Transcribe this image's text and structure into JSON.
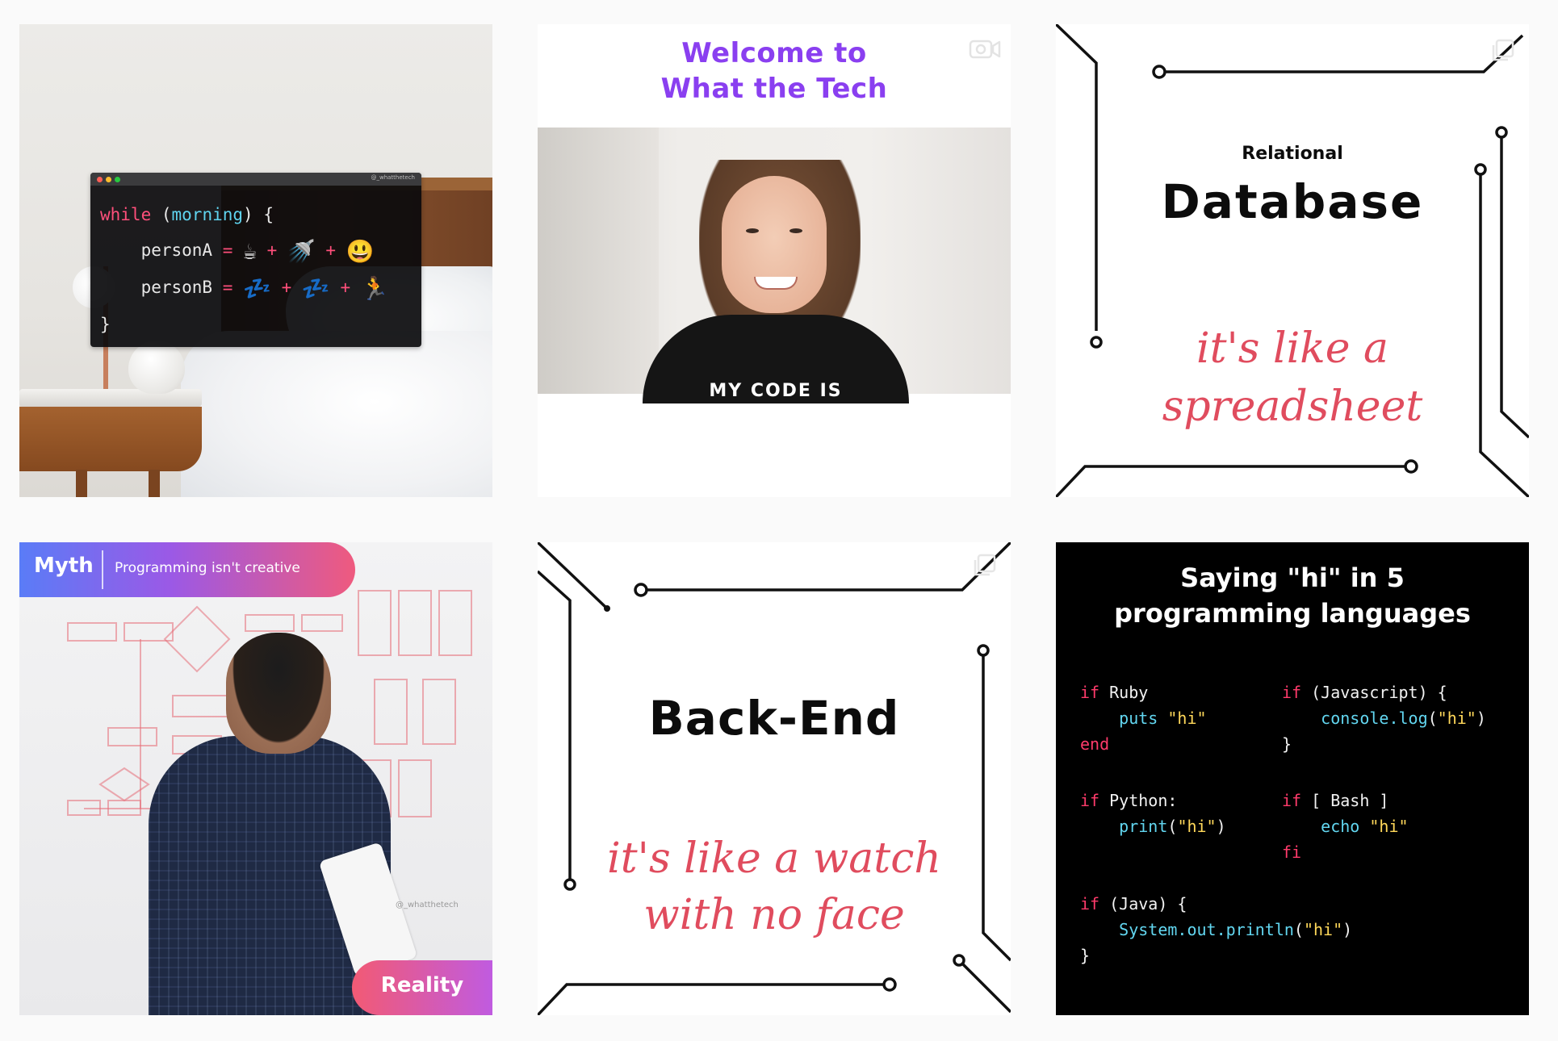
{
  "tiles": {
    "tile1": {
      "handle": "@_whatthetech",
      "code": {
        "line1_kw": "while",
        "line1_open": " (",
        "line1_var": "morning",
        "line1_close": ") {",
        "personA": "personA",
        "personB": "personB",
        "eq": "=",
        "plus": "+",
        "close": "}",
        "personA_emojis": [
          "☕",
          "🚿",
          "😃"
        ],
        "personB_emojis": [
          "💤",
          "💤",
          "🏃"
        ]
      }
    },
    "tile2": {
      "welcome_line1": "Welcome to",
      "welcome_line2": "What the Tech",
      "shirt_text": "MY CODE IS"
    },
    "tile3": {
      "eyebrow": "Relational",
      "title": "Database",
      "script_line1": "it's like a",
      "script_line2": "spreadsheet"
    },
    "tile4": {
      "myth_label": "Myth",
      "myth_text": "Programming isn't creative",
      "reality_label": "Reality",
      "watermark": "@_whatthetech"
    },
    "tile5": {
      "title": "Back-End",
      "script_line1": "it's like a watch",
      "script_line2": "with no face"
    },
    "tile6": {
      "title_line1": "Saying \"hi\" in 5",
      "title_line2": "programming languages",
      "ruby": {
        "kw_if": "if",
        "lang": "Ruby",
        "puts": "puts",
        "str": "\"hi\"",
        "end": "end"
      },
      "javascript": {
        "kw_if": "if",
        "cond": "(Javascript) {",
        "call": "console.log",
        "open": "(",
        "str": "\"hi\"",
        "close": ")",
        "brace": "}"
      },
      "python": {
        "kw_if": "if",
        "cond": "Python:",
        "call": "print",
        "open": "(",
        "str": "\"hi\"",
        "close": ")"
      },
      "bash": {
        "kw_if": "if",
        "cond": "[ Bash ]",
        "call": "echo",
        "str": "\"hi\"",
        "fi": "fi"
      },
      "java": {
        "kw_if": "if",
        "cond": "(Java) {",
        "call": "System.out.println",
        "open": "(",
        "str": "\"hi\"",
        "close": ")",
        "brace": "}"
      }
    }
  },
  "icons": {
    "video": "video-camera-icon",
    "carousel": "multiple-images-icon"
  },
  "colors": {
    "welcome_purple": "#8a3ff0",
    "script_red": "#e04c5e",
    "keyword_pink": "#ff3b6b",
    "method_cyan": "#62d6f0",
    "string_yellow": "#ffd85a"
  }
}
